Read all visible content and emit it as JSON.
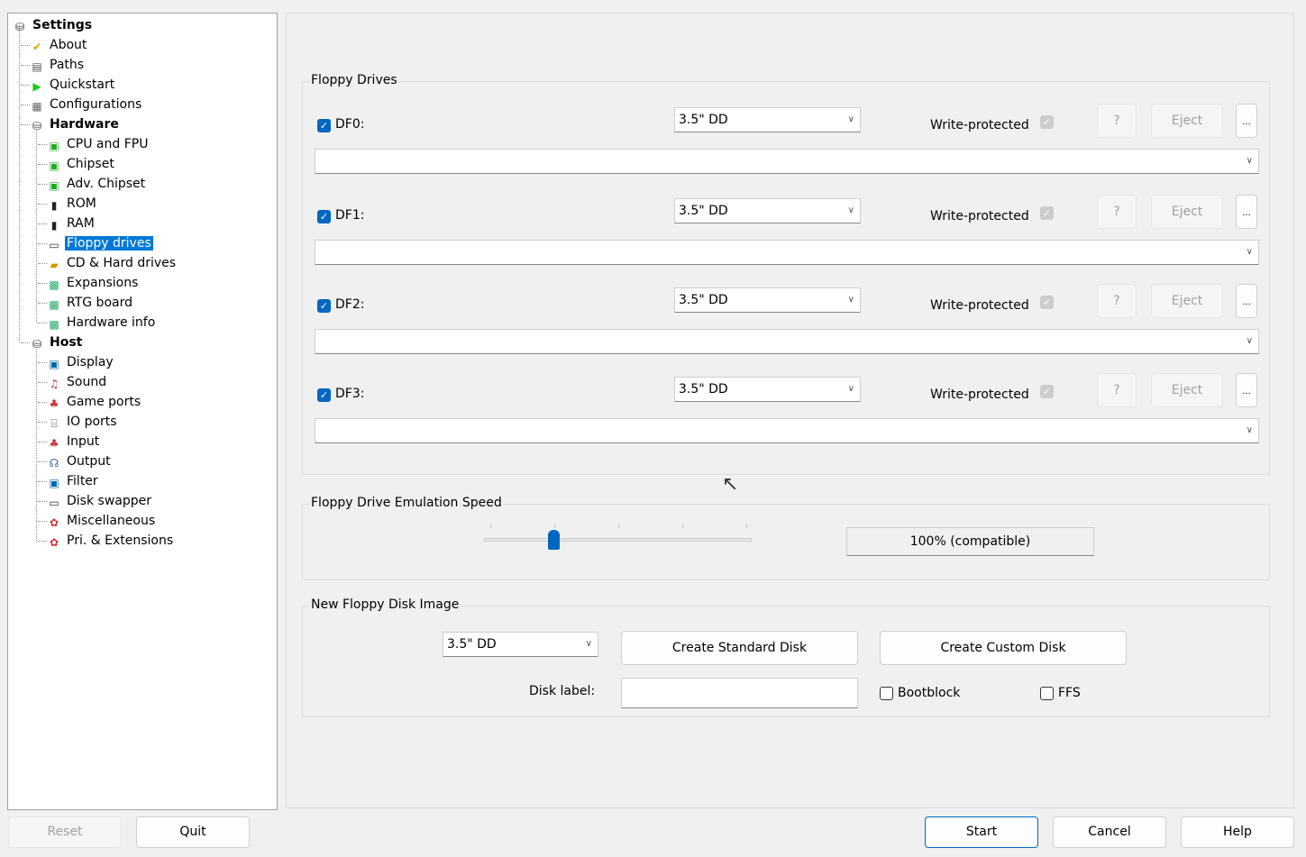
{
  "tree": [
    {
      "label": "Settings",
      "level": 0,
      "bold": true,
      "icon": "disk-stack-icon"
    },
    {
      "label": "About",
      "level": 1,
      "icon": "checkmark-icon"
    },
    {
      "label": "Paths",
      "level": 1,
      "icon": "paths-icon"
    },
    {
      "label": "Quickstart",
      "level": 1,
      "icon": "play-icon"
    },
    {
      "label": "Configurations",
      "level": 1,
      "icon": "configurations-icon"
    },
    {
      "label": "Hardware",
      "level": 1,
      "bold": true,
      "icon": "disk-stack-icon"
    },
    {
      "label": "CPU and FPU",
      "level": 2,
      "icon": "chip-icon"
    },
    {
      "label": "Chipset",
      "level": 2,
      "icon": "chip-icon"
    },
    {
      "label": "Adv. Chipset",
      "level": 2,
      "icon": "chip-icon"
    },
    {
      "label": "ROM",
      "level": 2,
      "icon": "memory-chip-icon"
    },
    {
      "label": "RAM",
      "level": 2,
      "icon": "memory-chip-icon"
    },
    {
      "label": "Floppy drives",
      "level": 2,
      "icon": "floppy-drive-icon",
      "selected": true
    },
    {
      "label": "CD & Hard drives",
      "level": 2,
      "icon": "hard-drive-icon"
    },
    {
      "label": "Expansions",
      "level": 2,
      "icon": "expansion-board-icon"
    },
    {
      "label": "RTG board",
      "level": 2,
      "icon": "expansion-board-icon"
    },
    {
      "label": "Hardware info",
      "level": 2,
      "icon": "expansion-board-icon"
    },
    {
      "label": "Host",
      "level": 1,
      "bold": true,
      "icon": "disk-stack-icon"
    },
    {
      "label": "Display",
      "level": 2,
      "icon": "monitor-icon"
    },
    {
      "label": "Sound",
      "level": 2,
      "icon": "speaker-icon"
    },
    {
      "label": "Game ports",
      "level": 2,
      "icon": "joystick-icon"
    },
    {
      "label": "IO ports",
      "level": 2,
      "icon": "io-port-icon"
    },
    {
      "label": "Input",
      "level": 2,
      "icon": "joystick-icon"
    },
    {
      "label": "Output",
      "level": 2,
      "icon": "output-icon"
    },
    {
      "label": "Filter",
      "level": 2,
      "icon": "monitor-icon"
    },
    {
      "label": "Disk swapper",
      "level": 2,
      "icon": "floppy-drive-icon"
    },
    {
      "label": "Miscellaneous",
      "level": 2,
      "icon": "misc-icon"
    },
    {
      "label": "Pri. & Extensions",
      "level": 2,
      "icon": "misc-icon"
    }
  ],
  "floppy": {
    "title": "Floppy Drives",
    "drives": [
      {
        "label": "DF0:",
        "enabled": true,
        "type": "3.5\" DD",
        "write_protected_label": "Write-protected",
        "help": "?",
        "eject": "Eject",
        "browse": "...",
        "path": ""
      },
      {
        "label": "DF1:",
        "enabled": true,
        "type": "3.5\" DD",
        "write_protected_label": "Write-protected",
        "help": "?",
        "eject": "Eject",
        "browse": "...",
        "path": ""
      },
      {
        "label": "DF2:",
        "enabled": true,
        "type": "3.5\" DD",
        "write_protected_label": "Write-protected",
        "help": "?",
        "eject": "Eject",
        "browse": "...",
        "path": ""
      },
      {
        "label": "DF3:",
        "enabled": true,
        "type": "3.5\" DD",
        "write_protected_label": "Write-protected",
        "help": "?",
        "eject": "Eject",
        "browse": "...",
        "path": ""
      }
    ]
  },
  "speed": {
    "title": "Floppy Drive Emulation Speed",
    "value_label": "100% (compatible)",
    "slider_position_fraction": 0.26
  },
  "newdisk": {
    "title": "New Floppy Disk Image",
    "type": "3.5\" DD",
    "create_standard": "Create Standard Disk",
    "create_custom": "Create Custom Disk",
    "disk_label": "Disk label:",
    "disk_label_value": "",
    "bootblock": "Bootblock",
    "ffs": "FFS"
  },
  "footer": {
    "reset": "Reset",
    "quit": "Quit",
    "start": "Start",
    "cancel": "Cancel",
    "help": "Help"
  }
}
